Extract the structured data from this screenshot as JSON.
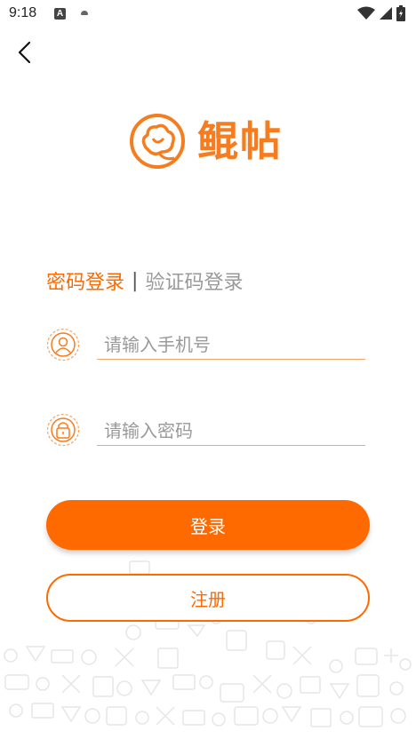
{
  "status_bar": {
    "time": "9:18",
    "notification_icons": [
      "a-icon",
      "cloud-icon"
    ],
    "system_icons": [
      "wifi-icon",
      "signal-icon",
      "battery-icon"
    ]
  },
  "header": {
    "back_icon": "chevron-left-icon"
  },
  "logo": {
    "icon": "cotton-logo-icon",
    "text": "鲲帖",
    "color": "#f57c1f"
  },
  "tabs": {
    "active": "密码登录",
    "separator": "|",
    "inactive": "验证码登录"
  },
  "form": {
    "phone": {
      "placeholder": "请输入手机号",
      "value": "",
      "icon": "user-icon"
    },
    "password": {
      "placeholder": "请输入密码",
      "value": "",
      "icon": "lock-icon"
    }
  },
  "buttons": {
    "login": "登录",
    "register": "注册"
  },
  "colors": {
    "accent": "#ff6a00",
    "underline": "#f3a66a",
    "placeholder": "#9a9a9a"
  }
}
